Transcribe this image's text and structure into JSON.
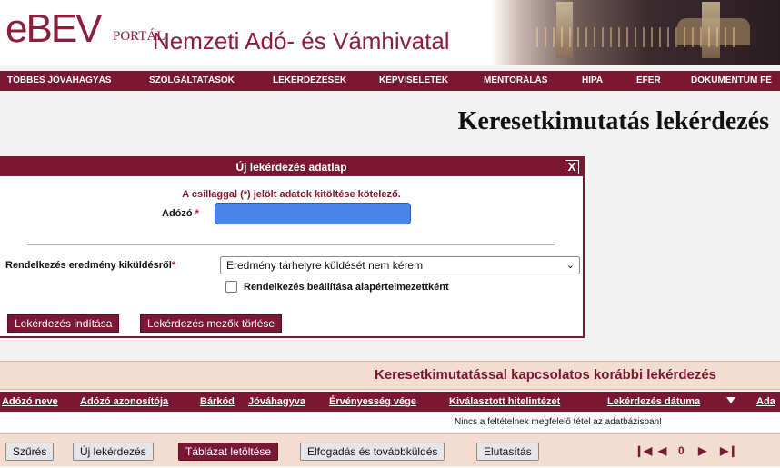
{
  "header": {
    "logo_main": "eBEV",
    "logo_sub": "PORTÁL",
    "title": "Nemzeti Adó- és Vámhivatal"
  },
  "nav": {
    "items": [
      "TÖBBES JÓVÁHAGYÁS",
      "SZOLGÁLTATÁSOK",
      "LEKÉRDEZÉSEK",
      "KÉPVISELETEK",
      "MENTORÁLÁS",
      "HIPA",
      "EFER",
      "DOKUMENTUM FE"
    ]
  },
  "page_title": "Keresetkimutatás lekérdezés",
  "form": {
    "title": "Új lekérdezés adatlap",
    "close_label": "X",
    "required_note": "A csillaggal (*) jelölt adatok kitöltése kötelező.",
    "adozo_label": "Adózó",
    "required_star": "*",
    "adozo_value": "",
    "delivery_label": "Rendelkezés eredmény kiküldésről",
    "delivery_selected": "Eredmény tárhelyre küldését nem kérem",
    "default_checkbox_label": "Rendelkezés beállítása alapértelmezettként",
    "start_button": "Lekérdezés indítása",
    "clear_button": "Lekérdezés mezők törlése"
  },
  "results": {
    "title": "Keresetkimutatással kapcsolatos korábbi lekérdezés",
    "columns": [
      "Adózó neve",
      "Adózó azonosítója",
      "Bárkód",
      "Jóváhagyva",
      "Érvényesség vége",
      "Kiválasztott hitelintézet",
      "Lekérdezés dátuma",
      "Ada"
    ],
    "empty_message": "Nincs a feltételnek megfelelő tétel az adatbázisban!",
    "toolbar": {
      "filter": "Szűrés",
      "new_query": "Új lekérdezés",
      "download_table": "Táblázat letöltése",
      "accept_forward": "Elfogadás és továbbküldés",
      "reject": "Elutasítás"
    },
    "pager": {
      "first": "❙◀",
      "prev": "◀",
      "page": "0",
      "next": "▶",
      "last": "▶❙"
    }
  },
  "colors": {
    "brand": "#7a1833",
    "input_highlight": "#4a86e8",
    "required": "#d0021b"
  }
}
